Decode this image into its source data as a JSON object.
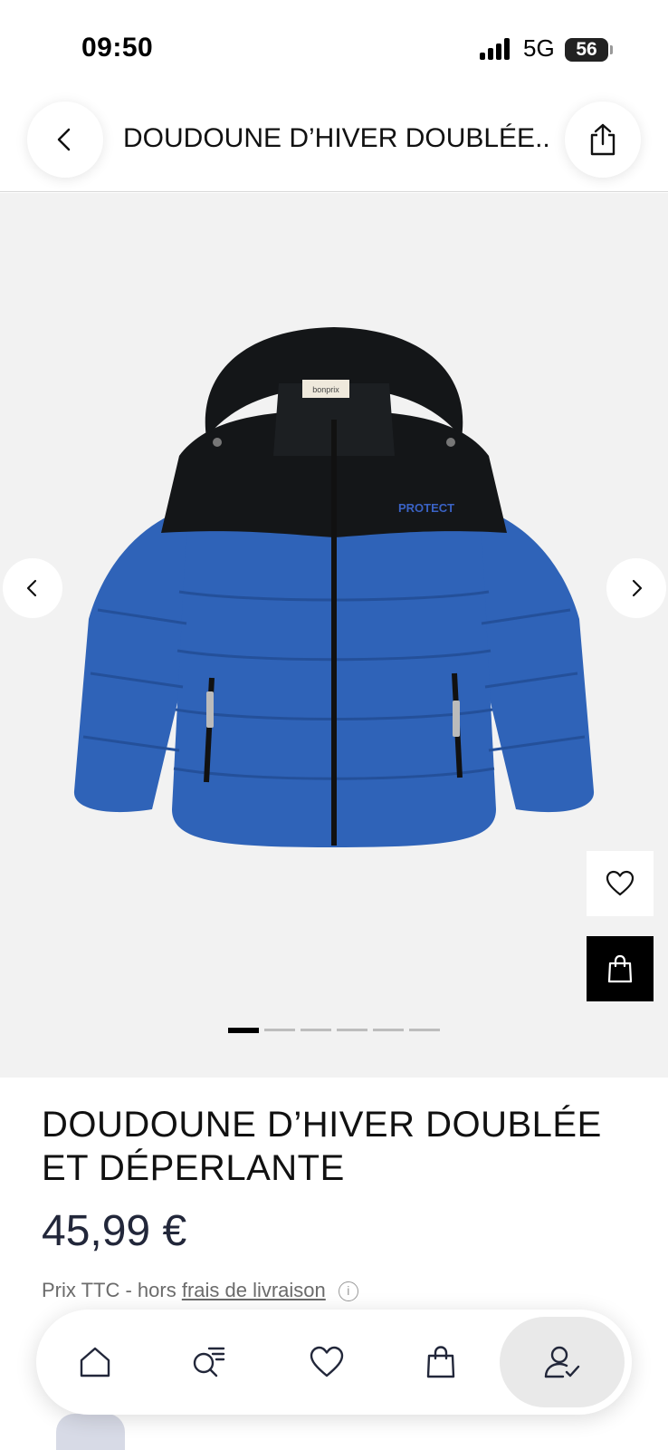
{
  "status_bar": {
    "time": "09:50",
    "network": "5G",
    "battery": "56"
  },
  "header": {
    "title": "DOUDOUNE D’HIVER DOUBLÉE...",
    "back_icon": "chevron-left-icon",
    "share_icon": "share-icon"
  },
  "gallery": {
    "jacket_label": "bonprix",
    "jacket_logo": "PROTECT",
    "image_count": 6,
    "active_image": 1,
    "colors": {
      "body": "#2f63b8",
      "yoke": "#141618",
      "background": "#f2f2f2"
    }
  },
  "product": {
    "title": "DOUDOUNE D’HIVER DOUBLÉE ET DÉPERLANTE",
    "price": "45,99 €",
    "tax_prefix": "Prix TTC - hors ",
    "tax_link": "frais de livraison"
  },
  "bottom_nav": {
    "items": [
      {
        "icon": "home-icon"
      },
      {
        "icon": "search-list-icon"
      },
      {
        "icon": "heart-icon"
      },
      {
        "icon": "shopping-bag-icon"
      },
      {
        "icon": "account-icon",
        "active": true
      }
    ]
  }
}
